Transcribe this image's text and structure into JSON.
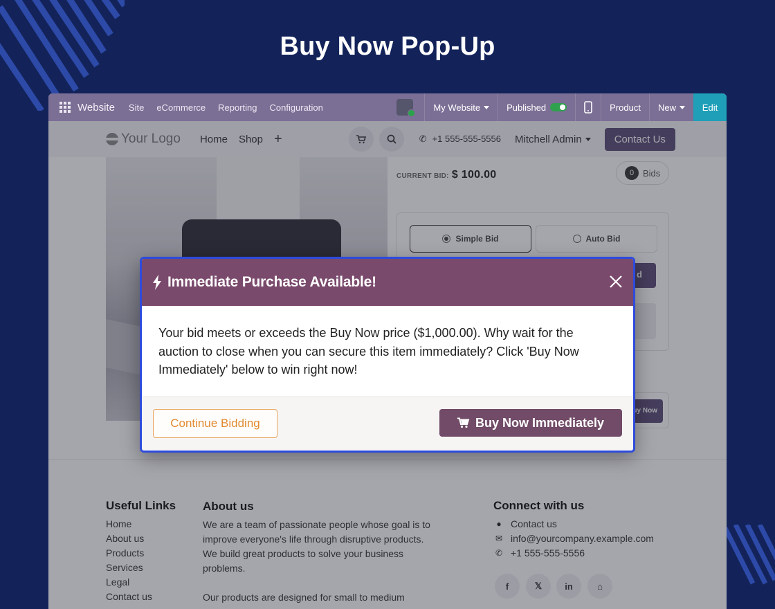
{
  "hero": {
    "title": "Buy Now Pop-Up"
  },
  "adminbar": {
    "brand": "Website",
    "menus": [
      "Site",
      "eCommerce",
      "Reporting",
      "Configuration"
    ],
    "website_selector": "My Website",
    "published_label": "Published",
    "product_label": "Product",
    "new_label": "New",
    "edit_label": "Edit",
    "colors": {
      "bar": "#7c6f95",
      "edit": "#1f9fb8",
      "toggle_on": "#2fa04e"
    }
  },
  "header": {
    "logo_text": "Your Logo",
    "nav": [
      "Home",
      "Shop"
    ],
    "plus": "+",
    "phone": "+1 555-555-5556",
    "user": "Mitchell Admin",
    "contact_button": "Contact Us"
  },
  "auction": {
    "current_bid_label": "CURRENT BID:",
    "current_bid_value": "$ 100.00",
    "bids_count": "0",
    "bids_label": "Bids",
    "bid_types": [
      "Simple Bid",
      "Auto Bid"
    ],
    "selected_bid_type": "Simple Bid",
    "place_bid_fragment": "d",
    "buy_now_fragment": "uy Now"
  },
  "modal": {
    "title": "Immediate Purchase Available!",
    "message": "Your bid meets or exceeds the Buy Now price ($1,000.00). Why wait for the auction to close when you can secure this item immediately? Click 'Buy Now Immediately' below to win right now!",
    "continue_button": "Continue Bidding",
    "buy_button": "Buy Now Immediately",
    "colors": {
      "header": "#7a4a6c",
      "border": "#2e4bdd",
      "buy": "#714b67",
      "continue": "#e08a30"
    }
  },
  "footer": {
    "useful_links_title": "Useful Links",
    "useful_links": [
      "Home",
      "About us",
      "Products",
      "Services",
      "Legal",
      "Contact us"
    ],
    "about_title": "About us",
    "about_p1": "We are a team of passionate people whose goal is to improve everyone's life through disruptive products. We build great products to solve your business problems.",
    "about_p2": "Our products are designed for small to medium",
    "connect_title": "Connect with us",
    "contact_items": [
      {
        "icon": "comment-icon",
        "text": "Contact us"
      },
      {
        "icon": "envelope-icon",
        "text": "info@yourcompany.example.com"
      },
      {
        "icon": "phone-icon",
        "text": "+1 555-555-5556"
      }
    ],
    "social": [
      {
        "icon": "facebook-icon",
        "glyph": "f"
      },
      {
        "icon": "x-twitter-icon",
        "glyph": "𝕏"
      },
      {
        "icon": "linkedin-icon",
        "glyph": "in"
      },
      {
        "icon": "home-icon",
        "glyph": "⌂"
      }
    ]
  }
}
